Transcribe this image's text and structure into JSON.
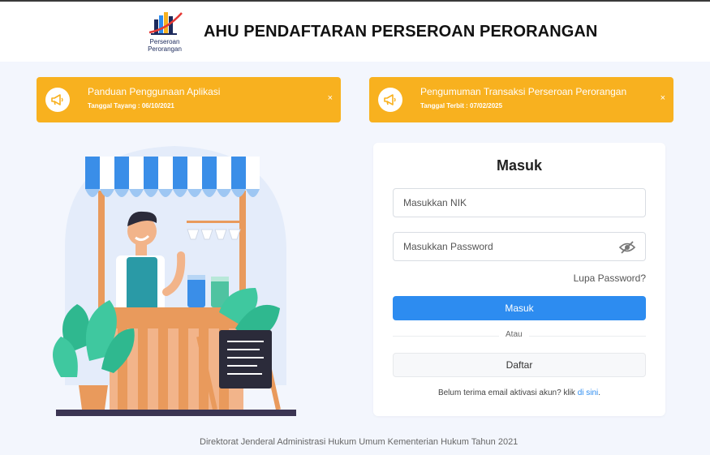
{
  "header": {
    "logo_line1": "Perseroan",
    "logo_line2": "Perorangan",
    "title": "AHU PENDAFTARAN PERSEROAN PERORANGAN"
  },
  "banners": [
    {
      "title": "Panduan Penggunaan Aplikasi",
      "date": "Tanggal Tayang : 06/10/2021",
      "icon": "megaphone-icon",
      "close": "×"
    },
    {
      "title": "Pengumuman Transaksi Perseroan Perorangan",
      "date": "Tanggal Terbit : 07/02/2025",
      "icon": "megaphone-icon",
      "close": "×"
    }
  ],
  "login": {
    "title": "Masuk",
    "nik_placeholder": "Masukkan NIK",
    "password_placeholder": "Masukkan Password",
    "forgot": "Lupa Password?",
    "submit": "Masuk",
    "or": "Atau",
    "register": "Daftar",
    "activation_text": "Belum terima email aktivasi akun? klik ",
    "activation_link": "di sini",
    "activation_end": "."
  },
  "footer": {
    "text": "Direktorat Jenderal Administrasi Hukum Umum Kementerian Hukum Tahun 2021"
  },
  "colors": {
    "banner": "#f8b11f",
    "primary": "#2d8cf0",
    "background": "#f3f6fd"
  }
}
